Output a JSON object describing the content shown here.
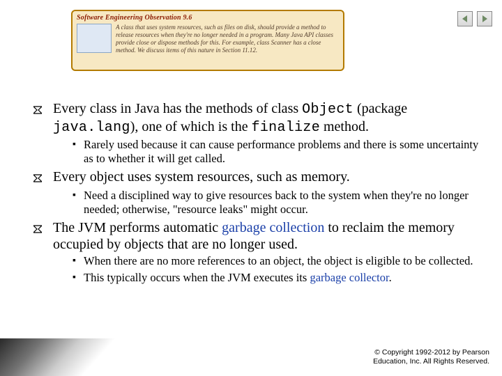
{
  "callout": {
    "header": "Software Engineering Observation 9.6",
    "body": "A class that uses system resources, such as files on disk, should provide a method to release resources when they're no longer needed in a program. Many Java API classes provide close or dispose methods for this. For example, class Scanner has a close method. We discuss items of this nature in Section 11.12."
  },
  "bullets": [
    {
      "segments": [
        {
          "t": "Every class in Java has the methods of class "
        },
        {
          "t": "Object",
          "mono": true
        },
        {
          "t": " (package "
        },
        {
          "t": "java.lang",
          "mono": true
        },
        {
          "t": "), one of which is the "
        },
        {
          "t": "finalize",
          "mono": true
        },
        {
          "t": " method."
        }
      ],
      "subs": [
        {
          "segments": [
            {
              "t": "Rarely used because it can cause performance problems and there is some uncertainty as to whether it will get called."
            }
          ]
        }
      ]
    },
    {
      "segments": [
        {
          "t": "Every object uses system resources, such as memory."
        }
      ],
      "subs": [
        {
          "segments": [
            {
              "t": "Need a disciplined way to give resources back to the system when they're no longer needed; otherwise, \"resource leaks\" might occur."
            }
          ]
        }
      ]
    },
    {
      "segments": [
        {
          "t": "The JVM performs automatic "
        },
        {
          "t": "garbage collection",
          "link": true
        },
        {
          "t": " to reclaim the memory occupied by objects that are no longer used."
        }
      ],
      "subs": [
        {
          "segments": [
            {
              "t": "When there are no more references to an object, the object is eligible to be collected."
            }
          ]
        },
        {
          "segments": [
            {
              "t": "This typically occurs when the JVM executes its "
            },
            {
              "t": "garbage collector",
              "link": true
            },
            {
              "t": "."
            }
          ]
        }
      ]
    }
  ],
  "footer": {
    "line1": "© Copyright 1992-2012 by Pearson",
    "line2": "Education, Inc. All Rights Reserved."
  }
}
